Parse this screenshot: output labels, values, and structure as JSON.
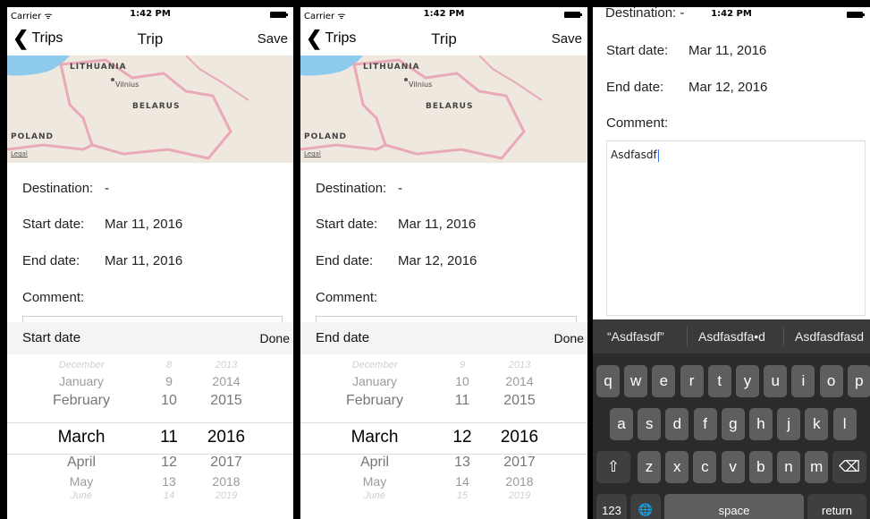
{
  "status": {
    "carrier": "Carrier ᯤ",
    "time": "1:42 PM"
  },
  "nav": {
    "back_label": "Trips",
    "title": "Trip",
    "save_label": "Save",
    "back_chevron": "❮"
  },
  "map": {
    "labels": {
      "lithuania": "LITHUANIA",
      "vilnius": "Vilnius",
      "belarus": "BELARUS",
      "poland": "POLAND"
    },
    "legal": "Legal"
  },
  "fields": {
    "destination_label": "Destination:",
    "destination_value": "-",
    "start_label": "Start date:",
    "end_label": "End date:",
    "comment_label": "Comment:"
  },
  "screens": [
    {
      "start_value": "Mar 11, 2016",
      "end_value": "Mar 11, 2016",
      "picker_label": "Start date",
      "done_label": "Done",
      "picker": {
        "months": [
          "December",
          "January",
          "February",
          "March",
          "April",
          "May",
          "June"
        ],
        "days": [
          "8",
          "9",
          "10",
          "11",
          "12",
          "13",
          "14"
        ],
        "years": [
          "2013",
          "2014",
          "2015",
          "2016",
          "2017",
          "2018",
          "2019"
        ]
      }
    },
    {
      "start_value": "Mar 11, 2016",
      "end_value": "Mar 12, 2016",
      "picker_label": "End date",
      "done_label": "Done",
      "picker": {
        "months": [
          "December",
          "January",
          "February",
          "March",
          "April",
          "May",
          "June"
        ],
        "days": [
          "9",
          "10",
          "11",
          "12",
          "13",
          "14",
          "15"
        ],
        "years": [
          "2013",
          "2014",
          "2015",
          "2016",
          "2017",
          "2018",
          "2019"
        ]
      }
    },
    {
      "destination_partial": "Destination: -",
      "start_value": "Mar 11, 2016",
      "end_value": "Mar 12, 2016",
      "comment_text": "Asdfasdf",
      "suggestions": [
        "“Asdfasdf”",
        "Asdfasdfa•d",
        "Asdfasdfasd"
      ],
      "keyboard": {
        "row1": [
          "q",
          "w",
          "e",
          "r",
          "t",
          "y",
          "u",
          "i",
          "o",
          "p"
        ],
        "row2": [
          "a",
          "s",
          "d",
          "f",
          "g",
          "h",
          "j",
          "k",
          "l"
        ],
        "row3": [
          "z",
          "x",
          "c",
          "v",
          "b",
          "n",
          "m"
        ],
        "shift": "⇧",
        "delete": "⌫",
        "numbers": "123",
        "globe": "🌐",
        "space": "space",
        "return": "return"
      }
    }
  ]
}
